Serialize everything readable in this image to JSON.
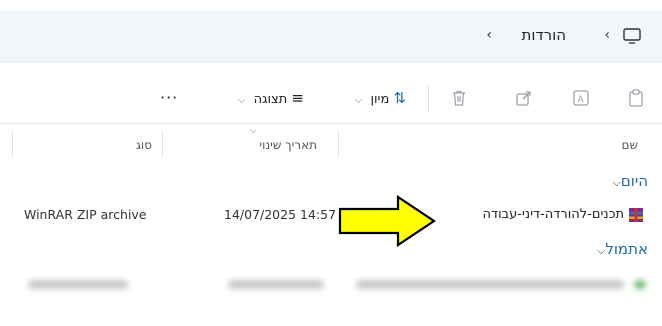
{
  "address": {
    "crumb": "הורדות"
  },
  "toolbar": {
    "sort_label": "מיון",
    "view_label": "תצוגה",
    "more_label": "···"
  },
  "columns": {
    "name": "שם",
    "modified": "תאריך שינוי",
    "type": "סוג"
  },
  "groups": {
    "today": "היום",
    "yesterday": "אתמול"
  },
  "files": [
    {
      "name": "תכנים-להורדה-דיני-עבודה",
      "modified": "14/07/2025 14:57",
      "type": "WinRAR ZIP archive",
      "icon": "winrar-archive-icon"
    }
  ],
  "colors": {
    "arrow_fill": "#ffff00",
    "group_text": "#1f6aa5",
    "address_bg": "#f3f6fb"
  }
}
